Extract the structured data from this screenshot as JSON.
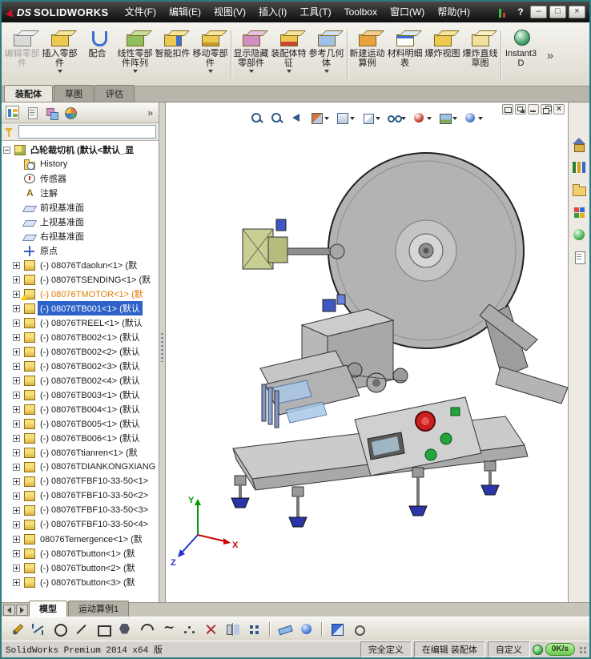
{
  "colors": {
    "selection": "#2e62c8",
    "warning_text": "#e07b00",
    "titlebar": "#222222",
    "brand_red": "#c8102e",
    "net_badge": "#6cc94e"
  },
  "titlebar": {
    "logo_prefix": "DS",
    "logo_text": "SOLIDWORKS",
    "menus": [
      "文件(F)",
      "编辑(E)",
      "视图(V)",
      "插入(I)",
      "工具(T)",
      "Toolbox",
      "窗口(W)",
      "帮助(H)"
    ],
    "help": "?",
    "minimize": "–",
    "maximize": "□",
    "close": "×"
  },
  "ribbon": {
    "overflow": "»",
    "buttons": [
      {
        "label": "编辑零部件",
        "name": "edit-component-button",
        "icon_name": "edit-component-icon",
        "icon_cls": "ic-edit",
        "cls": "disabled"
      },
      {
        "label": "插入零部件",
        "name": "insert-components-button",
        "icon_name": "insert-components-icon",
        "icon_cls": "ic-insert",
        "cls": "has-arrow"
      },
      {
        "label": "配合",
        "name": "mate-button",
        "icon_name": "mate-icon",
        "icon_cls": "ic-mate",
        "cls": ""
      },
      {
        "label": "线性零部件阵列",
        "name": "linear-component-pattern-button",
        "icon_name": "linear-pattern-icon",
        "icon_cls": "ic-linear",
        "cls": "has-arrow"
      },
      {
        "label": "智能扣件",
        "name": "smart-fasteners-button",
        "icon_name": "smart-fasteners-icon",
        "icon_cls": "ic-smart",
        "cls": ""
      },
      {
        "label": "移动零部件",
        "name": "move-component-button",
        "icon_name": "move-component-icon",
        "icon_cls": "ic-move",
        "cls": "has-arrow group-end"
      },
      {
        "label": "显示隐藏零部件",
        "name": "show-hidden-components-button",
        "icon_name": "show-hidden-components-icon",
        "icon_cls": "ic-showhide",
        "cls": "has-arrow"
      },
      {
        "label": "装配体特征",
        "name": "assembly-features-button",
        "icon_name": "assembly-features-icon",
        "icon_cls": "ic-asmfeat",
        "cls": "has-arrow"
      },
      {
        "label": "参考几何体",
        "name": "reference-geometry-button",
        "icon_name": "reference-geometry-icon",
        "icon_cls": "ic-refgeo",
        "cls": "has-arrow group-end"
      },
      {
        "label": "新建运动算例",
        "name": "new-motion-study-button",
        "icon_name": "new-motion-study-icon",
        "icon_cls": "ic-motion",
        "cls": ""
      },
      {
        "label": "材料明细表",
        "name": "bill-of-materials-button",
        "icon_name": "bill-of-materials-icon",
        "icon_cls": "ic-bom",
        "cls": ""
      },
      {
        "label": "爆炸视图",
        "name": "exploded-view-button",
        "icon_name": "exploded-view-icon",
        "icon_cls": "ic-explode",
        "cls": ""
      },
      {
        "label": "爆炸直线草图",
        "name": "explode-line-sketch-button",
        "icon_name": "explode-line-sketch-icon",
        "icon_cls": "ic-explsk",
        "cls": "group-end"
      },
      {
        "label": "Instant3D",
        "name": "instant3d-button",
        "icon_name": "instant3d-icon",
        "icon_cls": "ic-i3d",
        "cls": ""
      }
    ]
  },
  "command_tabs": [
    {
      "label": "装配体",
      "name": "tab-assembly",
      "cls": "active"
    },
    {
      "label": "草图",
      "name": "tab-sketch",
      "cls": ""
    },
    {
      "label": "评估",
      "name": "tab-evaluate",
      "cls": ""
    }
  ],
  "panel": {
    "chevron": "»",
    "filter_value": "",
    "tabs": [
      {
        "name": "featuremanager-tree-tab-icon",
        "cls": "pt-tree active"
      },
      {
        "name": "propertymanager-tab-icon",
        "cls": "pt-prop"
      },
      {
        "name": "configurationmanager-tab-icon",
        "cls": "pt-config"
      },
      {
        "name": "displaymanager-tab-icon",
        "cls": "pt-display"
      }
    ]
  },
  "tree": {
    "items": [
      {
        "label": "凸轮裁切机 (默认<默认_显",
        "icon_cls": "ico-asm",
        "icon_name": "assembly-icon",
        "row_cls": "root exp expanded"
      },
      {
        "label": "History",
        "icon_cls": "ico-history",
        "icon_name": "history-folder-icon",
        "row_cls": "child"
      },
      {
        "label": "传感器",
        "icon_cls": "ico-sensor",
        "icon_name": "sensors-folder-icon",
        "row_cls": "child"
      },
      {
        "label": "注解",
        "icon_cls": "ico-ann",
        "icon_name": "annotations-folder-icon",
        "row_cls": "child"
      },
      {
        "label": "前视基准面",
        "icon_cls": "ico-plane",
        "icon_name": "front-plane-icon",
        "row_cls": "child"
      },
      {
        "label": "上视基准面",
        "icon_cls": "ico-plane",
        "icon_name": "top-plane-icon",
        "row_cls": "child"
      },
      {
        "label": "右视基准面",
        "icon_cls": "ico-plane",
        "icon_name": "right-plane-icon",
        "row_cls": "child"
      },
      {
        "label": "原点",
        "icon_cls": "ico-origin",
        "icon_name": "origin-icon",
        "row_cls": "child"
      },
      {
        "label": "(-) 08076Tdaolun<1> (默",
        "icon_cls": "ico-part",
        "icon_name": "component-icon",
        "row_cls": "child exp"
      },
      {
        "label": "(-) 08076TSENDING<1> (默",
        "icon_cls": "ico-part",
        "icon_name": "component-icon",
        "row_cls": "child exp"
      },
      {
        "label": "(-) 08076TMOTOR<1> (默",
        "icon_cls": "ico-part",
        "icon_name": "component-warning-icon",
        "row_cls": "child exp warn"
      },
      {
        "label": "(-) 08076TB001<1> (默认",
        "icon_cls": "ico-part",
        "icon_name": "component-icon",
        "row_cls": "child exp selected"
      },
      {
        "label": "(-) 08076TREEL<1> (默认",
        "icon_cls": "ico-part",
        "icon_name": "component-icon",
        "row_cls": "child exp"
      },
      {
        "label": "(-) 08076TB002<1> (默认",
        "icon_cls": "ico-part",
        "icon_name": "component-icon",
        "row_cls": "child exp"
      },
      {
        "label": "(-) 08076TB002<2> (默认",
        "icon_cls": "ico-part",
        "icon_name": "component-icon",
        "row_cls": "child exp"
      },
      {
        "label": "(-) 08076TB002<3> (默认",
        "icon_cls": "ico-part",
        "icon_name": "component-icon",
        "row_cls": "child exp"
      },
      {
        "label": "(-) 08076TB002<4> (默认",
        "icon_cls": "ico-part",
        "icon_name": "component-icon",
        "row_cls": "child exp"
      },
      {
        "label": "(-) 08076TB003<1> (默认",
        "icon_cls": "ico-part",
        "icon_name": "component-icon",
        "row_cls": "child exp"
      },
      {
        "label": "(-) 08076TB004<1> (默认",
        "icon_cls": "ico-part",
        "icon_name": "component-icon",
        "row_cls": "child exp"
      },
      {
        "label": "(-) 08076TB005<1> (默认",
        "icon_cls": "ico-part",
        "icon_name": "component-icon",
        "row_cls": "child exp"
      },
      {
        "label": "(-) 08076TB006<1> (默认",
        "icon_cls": "ico-part",
        "icon_name": "component-icon",
        "row_cls": "child exp"
      },
      {
        "label": "(-) 08076Ttianren<1> (默",
        "icon_cls": "ico-part",
        "icon_name": "component-icon",
        "row_cls": "child exp"
      },
      {
        "label": "(-) 08076TDIANKONGXIANG",
        "icon_cls": "ico-part",
        "icon_name": "component-icon",
        "row_cls": "child exp"
      },
      {
        "label": "(-) 08076TFBF10-33-50<1>",
        "icon_cls": "ico-part",
        "icon_name": "component-icon",
        "row_cls": "child exp"
      },
      {
        "label": "(-) 08076TFBF10-33-50<2>",
        "icon_cls": "ico-part",
        "icon_name": "component-icon",
        "row_cls": "child exp"
      },
      {
        "label": "(-) 08076TFBF10-33-50<3>",
        "icon_cls": "ico-part",
        "icon_name": "component-icon",
        "row_cls": "child exp"
      },
      {
        "label": "(-) 08076TFBF10-33-50<4>",
        "icon_cls": "ico-part",
        "icon_name": "component-icon",
        "row_cls": "child exp"
      },
      {
        "label": "08076Temergence<1> (默",
        "icon_cls": "ico-part",
        "icon_name": "component-icon",
        "row_cls": "child exp"
      },
      {
        "label": "(-) 08076Tbutton<1> (默",
        "icon_cls": "ico-part",
        "icon_name": "component-icon",
        "row_cls": "child exp"
      },
      {
        "label": "(-) 08076Tbutton<2> (默",
        "icon_cls": "ico-part",
        "icon_name": "component-icon",
        "row_cls": "child exp"
      },
      {
        "label": "(-) 08076Tbutton<3> (默",
        "icon_cls": "ico-part",
        "icon_name": "component-icon",
        "row_cls": "child exp"
      }
    ]
  },
  "hud": {
    "items": [
      {
        "name": "zoom-fit-icon",
        "cls": "hud-mag"
      },
      {
        "name": "zoom-area-icon",
        "cls": "hud-mag"
      },
      {
        "name": "previous-view-icon",
        "cls": "hud-prev"
      },
      {
        "name": "section-view-icon",
        "cls": "hud-section",
        "wrap_cls": "has-dd"
      },
      {
        "name": "view-orientation-icon",
        "cls": "hud-cube",
        "wrap_cls": "has-dd"
      },
      {
        "name": "display-style-icon",
        "cls": "hud-dispstyle",
        "wrap_cls": "has-dd"
      },
      {
        "name": "hide-show-items-icon",
        "cls": "hud-glasses",
        "wrap_cls": "has-dd"
      },
      {
        "name": "edit-appearance-icon",
        "cls": "hud-ball",
        "wrap_cls": "has-dd"
      },
      {
        "name": "apply-scene-icon",
        "cls": "hud-scene",
        "wrap_cls": "has-dd"
      },
      {
        "name": "view-settings-icon",
        "cls": "hud-settings",
        "wrap_cls": "has-dd"
      }
    ]
  },
  "doc_window": {
    "items": [
      {
        "name": "doc-pane-icon",
        "cls": "dw-pane"
      },
      {
        "name": "doc-tile-icon",
        "cls": "dw-tile"
      },
      {
        "name": "doc-minimize-icon",
        "cls": "dw-min"
      },
      {
        "name": "doc-restore-icon",
        "cls": "dw-restore"
      },
      {
        "name": "doc-close-icon",
        "cls": "dw-close"
      }
    ]
  },
  "task_pane": {
    "items": [
      {
        "name": "solidworks-resources-icon",
        "cls": "tp-home"
      },
      {
        "name": "design-library-icon",
        "cls": "tp-library"
      },
      {
        "name": "file-explorer-icon",
        "cls": "tp-folder"
      },
      {
        "name": "view-palette-icon",
        "cls": "tp-palette"
      },
      {
        "name": "appearances-scenes-icon",
        "cls": "tp-ball"
      },
      {
        "name": "custom-properties-icon",
        "cls": "tp-props"
      }
    ]
  },
  "doc_tabs": {
    "tabs": [
      {
        "label": "模型",
        "name": "tab-model",
        "cls": "active"
      },
      {
        "label": "运动算例1",
        "name": "tab-motion-study-1",
        "cls": ""
      }
    ]
  },
  "sketch_toolbar": {
    "icons": [
      {
        "name": "sketch-icon",
        "cls": "si-sketch"
      },
      {
        "name": "smart-dimension-icon",
        "cls": "si-dim"
      },
      {
        "name": "circle-icon",
        "cls": "si-circle"
      },
      {
        "name": "line-icon",
        "cls": "si-line"
      },
      {
        "name": "rectangle-icon",
        "cls": "si-rect"
      },
      {
        "name": "polygon-icon",
        "cls": "si-poly"
      },
      {
        "name": "arc-icon",
        "cls": "si-arc"
      },
      {
        "name": "spline-icon",
        "cls": "si-spline"
      },
      {
        "name": "point-icon",
        "cls": "si-point"
      },
      {
        "name": "trim-entities-icon",
        "cls": "si-trim"
      },
      {
        "name": "mirror-entities-icon",
        "cls": "si-mirror"
      },
      {
        "name": "linear-sketch-pattern-icon",
        "cls": "si-pattern"
      },
      {
        "name": "toolbar-separator",
        "cls": "si-sep"
      },
      {
        "name": "measure-icon",
        "cls": "si-measure"
      },
      {
        "name": "mass-properties-icon",
        "cls": "si-mass"
      },
      {
        "name": "toolbar-separator",
        "cls": "si-sep"
      },
      {
        "name": "section-properties-icon",
        "cls": "si-sectprop"
      },
      {
        "name": "options-icon",
        "cls": "si-options"
      }
    ]
  },
  "statusbar": {
    "left": "SolidWorks Premium 2014 x64 版",
    "segments": [
      {
        "label": "完全定义",
        "name": "status-fully-defined"
      },
      {
        "label": "在编辑 装配体",
        "name": "status-editing-assembly"
      },
      {
        "label": "自定义",
        "name": "status-customize-menu"
      }
    ],
    "net": "0K/s"
  },
  "viewport": {
    "triad": {
      "x": "X",
      "y": "Y",
      "z": "Z"
    }
  }
}
